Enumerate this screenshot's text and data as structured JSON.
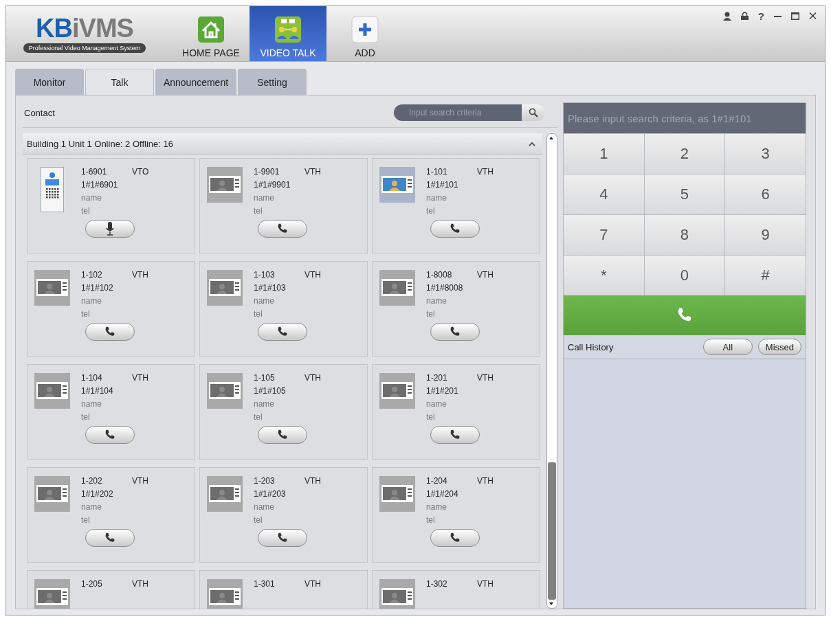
{
  "logo": {
    "title": "KBiVMS",
    "subtitle": "Professional Video Management System"
  },
  "nav": [
    {
      "label": "HOME PAGE",
      "kind": "home",
      "selected": false
    },
    {
      "label": "VIDEO TALK",
      "kind": "talk",
      "selected": true
    },
    {
      "label": "ADD",
      "kind": "add",
      "selected": false
    }
  ],
  "window_controls": {
    "help": "?"
  },
  "tabs": [
    {
      "label": "Monitor",
      "selected": false
    },
    {
      "label": "Talk",
      "selected": true
    },
    {
      "label": "Announcement",
      "selected": false
    },
    {
      "label": "Setting",
      "selected": false
    }
  ],
  "contact": {
    "title": "Contact",
    "search": {
      "placeholder": "Input search criteria"
    }
  },
  "group": {
    "title": "Building 1 Unit 1 Online: 2 Offline: 16",
    "expanded": true
  },
  "devices": [
    {
      "id": "1-6901",
      "type": "VTO",
      "address": "1#1#6901",
      "name": "name",
      "tel": "tel",
      "kind": "vto",
      "online": true
    },
    {
      "id": "1-9901",
      "type": "VTH",
      "address": "1#1#9901",
      "name": "name",
      "tel": "tel",
      "kind": "vth",
      "online": false
    },
    {
      "id": "1-101",
      "type": "VTH",
      "address": "1#1#101",
      "name": "name",
      "tel": "tel",
      "kind": "vth",
      "online": true
    },
    {
      "id": "1-102",
      "type": "VTH",
      "address": "1#1#102",
      "name": "name",
      "tel": "tel",
      "kind": "vth",
      "online": false
    },
    {
      "id": "1-103",
      "type": "VTH",
      "address": "1#1#103",
      "name": "name",
      "tel": "tel",
      "kind": "vth",
      "online": false
    },
    {
      "id": "1-8008",
      "type": "VTH",
      "address": "1#1#8008",
      "name": "name",
      "tel": "tel",
      "kind": "vth",
      "online": false
    },
    {
      "id": "1-104",
      "type": "VTH",
      "address": "1#1#104",
      "name": "name",
      "tel": "tel",
      "kind": "vth",
      "online": false
    },
    {
      "id": "1-105",
      "type": "VTH",
      "address": "1#1#105",
      "name": "name",
      "tel": "tel",
      "kind": "vth",
      "online": false
    },
    {
      "id": "1-201",
      "type": "VTH",
      "address": "1#1#201",
      "name": "name",
      "tel": "tel",
      "kind": "vth",
      "online": false
    },
    {
      "id": "1-202",
      "type": "VTH",
      "address": "1#1#202",
      "name": "name",
      "tel": "tel",
      "kind": "vth",
      "online": false
    },
    {
      "id": "1-203",
      "type": "VTH",
      "address": "1#1#203",
      "name": "name",
      "tel": "tel",
      "kind": "vth",
      "online": false
    },
    {
      "id": "1-204",
      "type": "VTH",
      "address": "1#1#204",
      "name": "name",
      "tel": "tel",
      "kind": "vth",
      "online": false
    },
    {
      "id": "1-205",
      "type": "VTH",
      "kind": "vth",
      "online": false
    },
    {
      "id": "1-301",
      "type": "VTH",
      "kind": "vth",
      "online": false
    },
    {
      "id": "1-302",
      "type": "VTH",
      "kind": "vth",
      "online": false
    }
  ],
  "dialer": {
    "search": {
      "placeholder": "Please input search criteria, as 1#1#101"
    },
    "keys": [
      "1",
      "2",
      "3",
      "4",
      "5",
      "6",
      "7",
      "8",
      "9",
      "*",
      "0",
      "#"
    ]
  },
  "call_history": {
    "title": "Call History",
    "filters": [
      {
        "label": "All",
        "selected": false
      },
      {
        "label": "Missed",
        "selected": false
      }
    ]
  }
}
